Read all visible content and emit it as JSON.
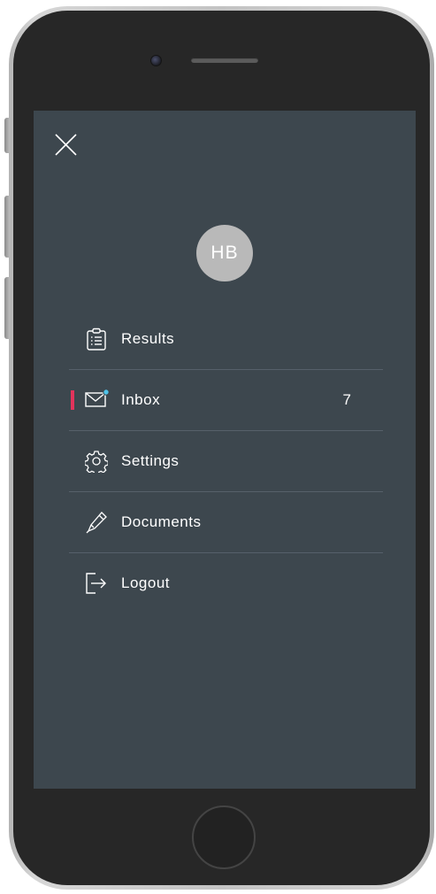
{
  "menu": {
    "close_icon": "close-icon",
    "user": {
      "initials": "HB"
    },
    "items": [
      {
        "label": "Results",
        "icon": "clipboard-icon"
      },
      {
        "label": "Inbox",
        "icon": "mail-icon",
        "count": "7",
        "active": true
      },
      {
        "label": "Settings",
        "icon": "gear-icon"
      },
      {
        "label": "Documents",
        "icon": "pen-icon"
      },
      {
        "label": "Logout",
        "icon": "logout-icon"
      }
    ]
  },
  "colors": {
    "screen_bg": "#3d474e",
    "avatar_bg": "#b9b9b9",
    "active_indicator": "#e3345c",
    "notification_dot": "#4fc3e8",
    "divider": "#56606a",
    "text": "#ffffff"
  }
}
